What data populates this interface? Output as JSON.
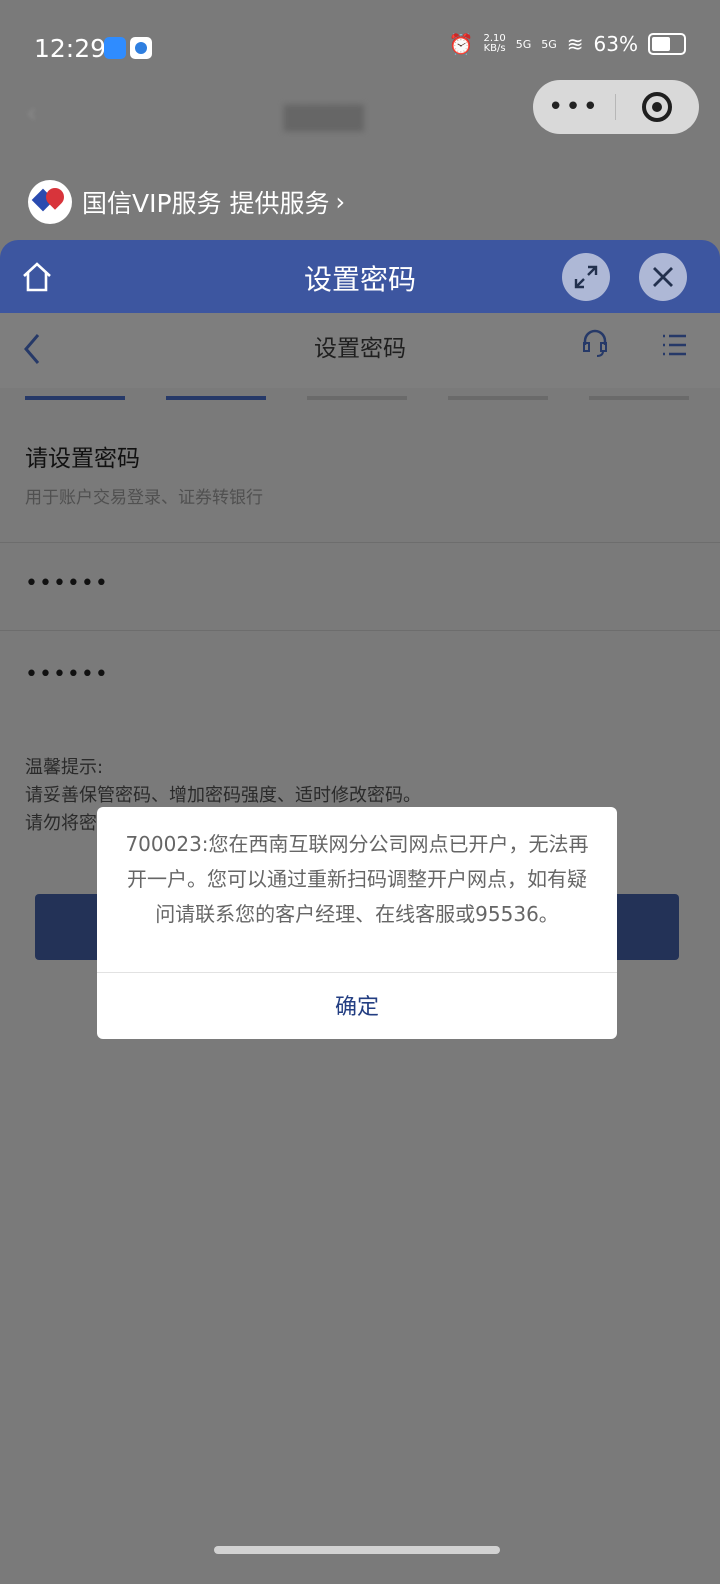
{
  "status_bar": {
    "time": "12:29",
    "speed_value": "2.10",
    "speed_unit": "KB/s",
    "network_1": "5G",
    "network_2": "5G",
    "battery": "63%"
  },
  "mini_program": {
    "capsule_menu": "•••",
    "provider": "国信VIP服务 提供服务"
  },
  "panel": {
    "title": "设置密码"
  },
  "page": {
    "nav_title": "设置密码",
    "heading": "请设置密码",
    "subheading": "用于账户交易登录、证券转银行",
    "password_1": "••••••",
    "password_2": "••••••",
    "tips_title": "温馨提示:",
    "tip_1": "请妥善保管密码、增加密码强度、适时修改密码。",
    "tip_2_visible": "请勿将密"
  },
  "dialog": {
    "message": "700023:您在西南互联网分公司网点已开户，无法再开一户。您可以通过重新扫码调整开户网点，如有疑问请联系您的客户经理、在线客服或95536。",
    "confirm": "确定"
  },
  "colors": {
    "panel_blue": "#3d56a0",
    "dark_blue": "#233257",
    "overlay_gray": "#7a7a7a"
  }
}
